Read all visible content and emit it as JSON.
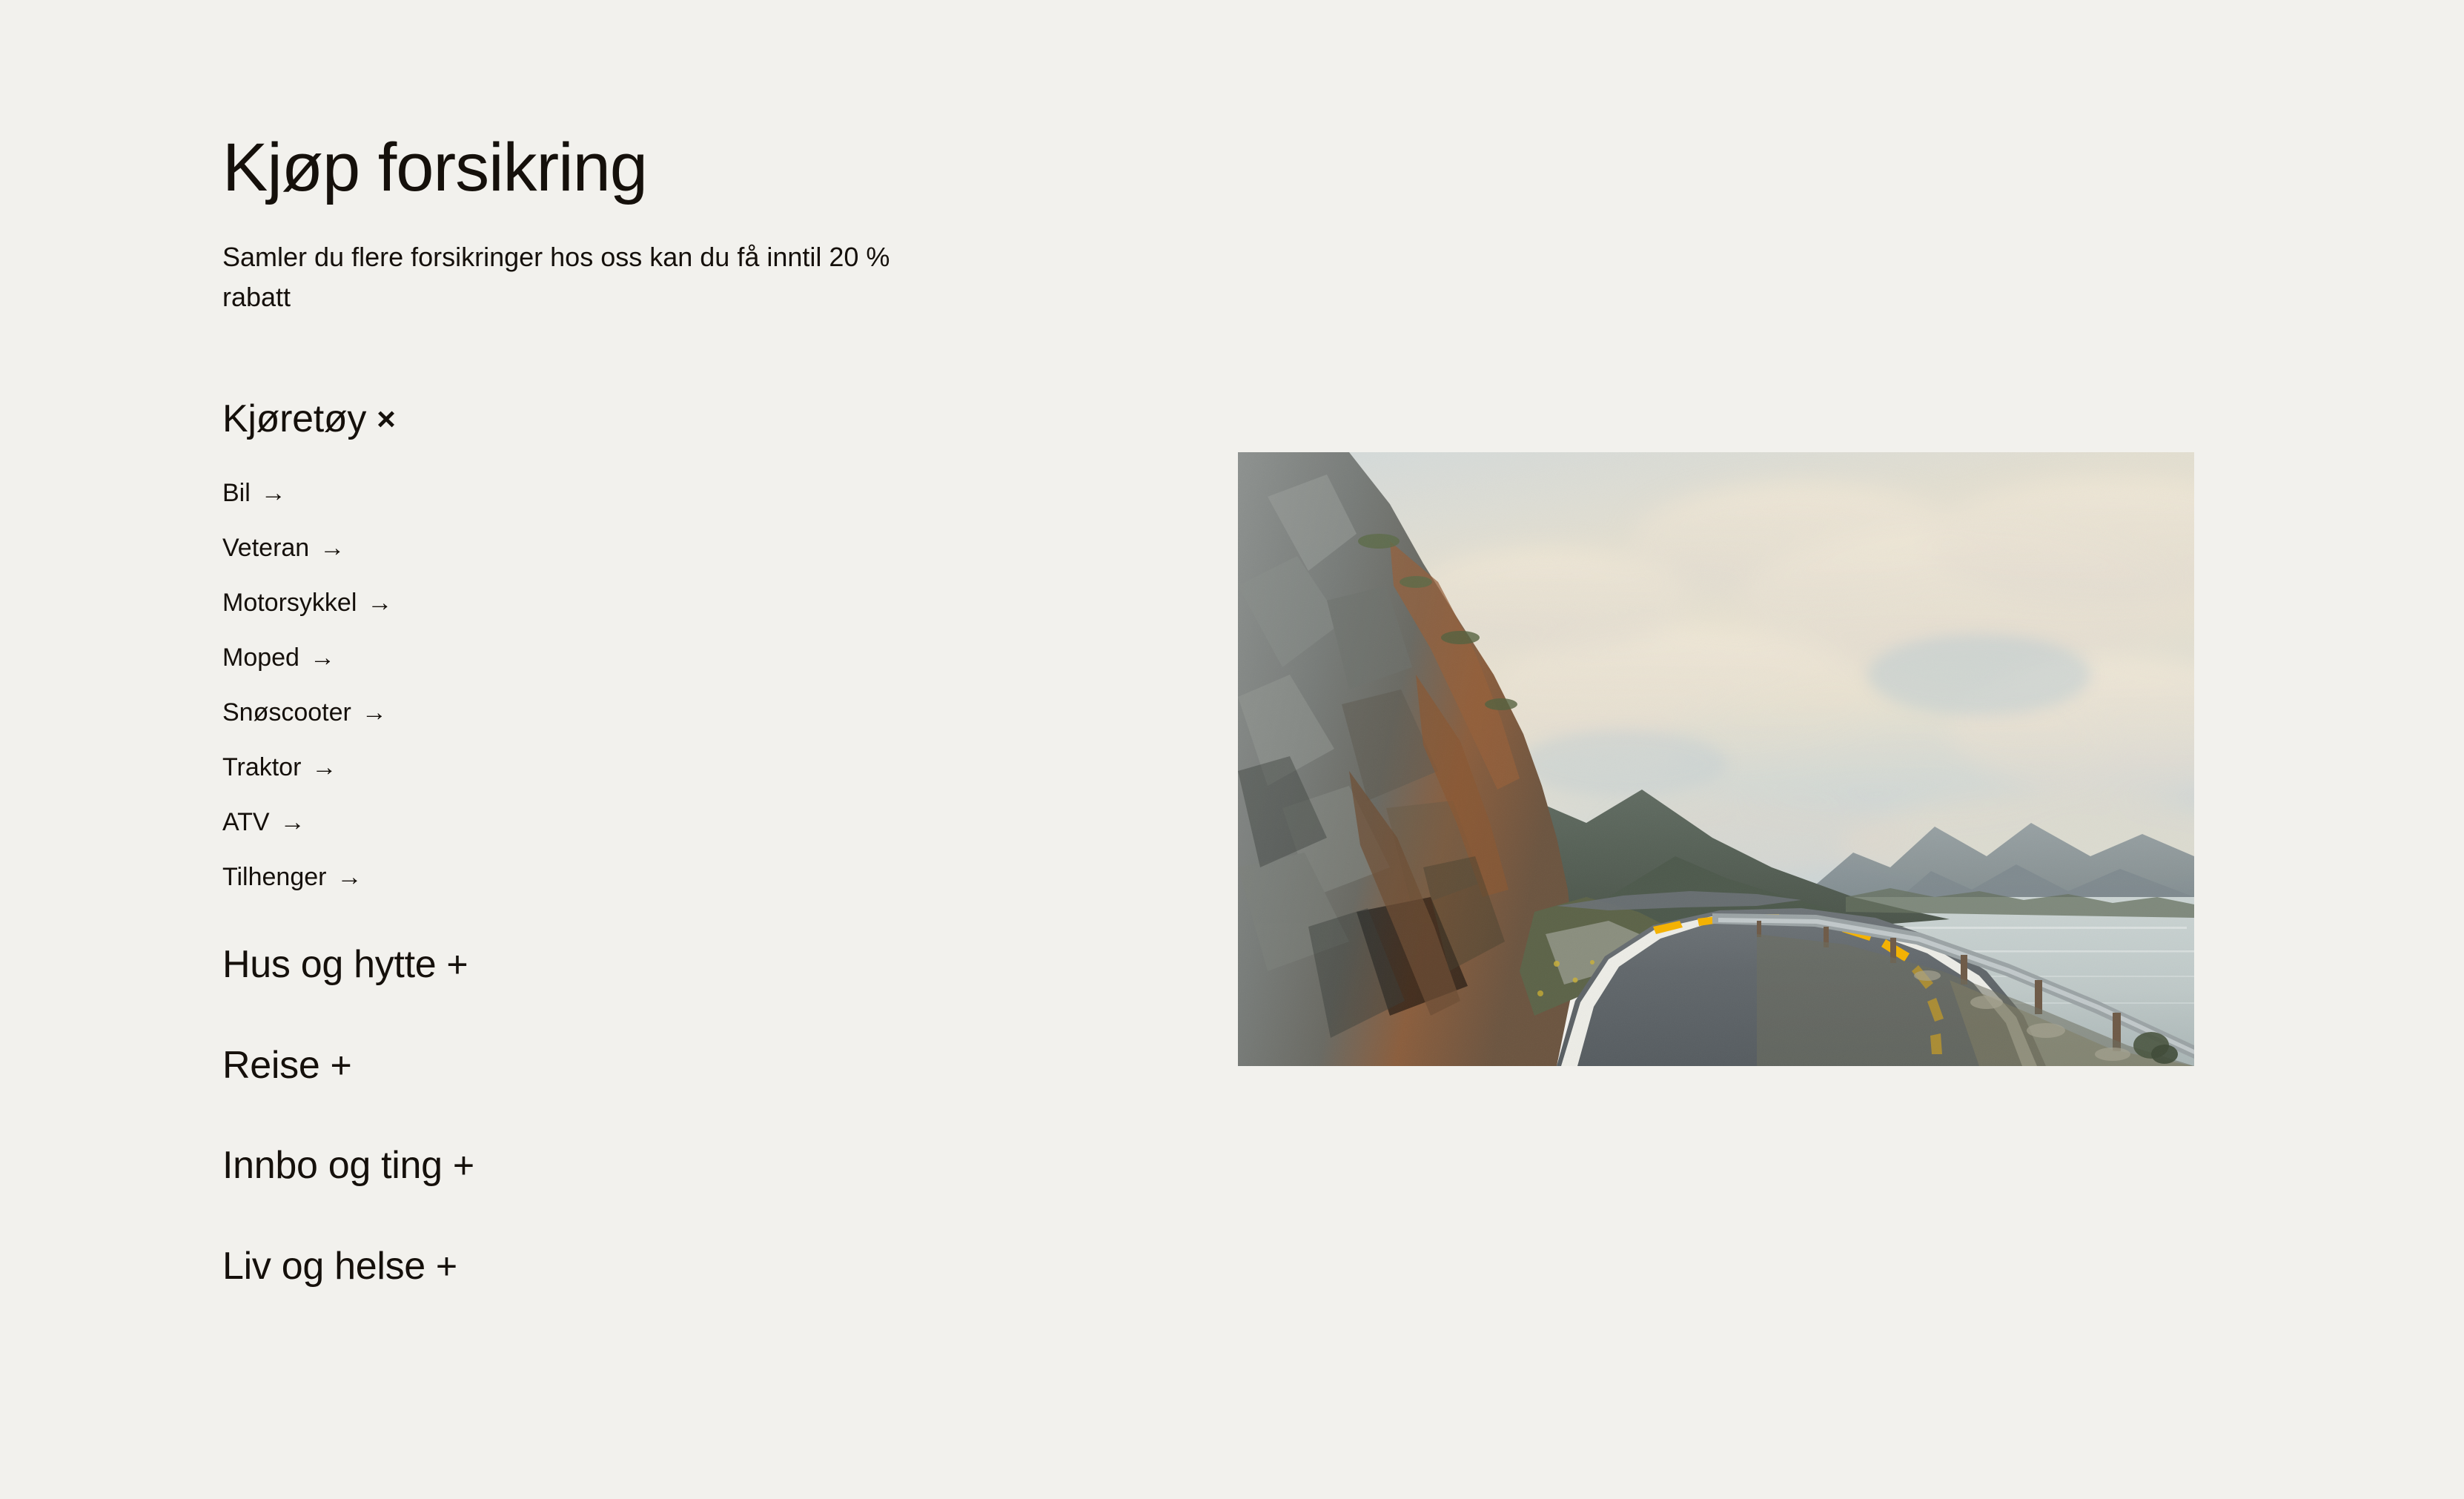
{
  "page": {
    "title": "Kjøp forsikring",
    "intro": "Samler du flere forsikringer hos oss kan du få inntil 20 % rabatt",
    "background_color": "#F2F1ED",
    "text_color": "#15100B"
  },
  "accordion": {
    "expanded_symbol": "×",
    "collapsed_symbol": "+",
    "link_arrow": "→",
    "items": [
      {
        "label": "Kjøretøy",
        "state": "expanded",
        "symbol": "×",
        "links": [
          {
            "label": "Bil",
            "arrow": "→"
          },
          {
            "label": "Veteran",
            "arrow": "→"
          },
          {
            "label": "Motorsykkel",
            "arrow": "→"
          },
          {
            "label": "Moped",
            "arrow": "→"
          },
          {
            "label": "Snøscooter",
            "arrow": "→"
          },
          {
            "label": "Traktor",
            "arrow": "→"
          },
          {
            "label": "ATV",
            "arrow": "→"
          },
          {
            "label": "Tilhenger",
            "arrow": "→"
          }
        ]
      },
      {
        "label": "Hus og hytte",
        "state": "collapsed",
        "symbol": "+",
        "links": []
      },
      {
        "label": "Reise",
        "state": "collapsed",
        "symbol": "+",
        "links": []
      },
      {
        "label": "Innbo og ting",
        "state": "collapsed",
        "symbol": "+",
        "links": []
      },
      {
        "label": "Liv og helse",
        "state": "collapsed",
        "symbol": "+",
        "links": []
      }
    ]
  },
  "photo": {
    "description": "Coastal mountain road curving along a fjord with steep rock cliff on the left, guardrail and water on the right, cloudy sky",
    "colors": {
      "sky_warm": "#E8E0CE",
      "sky_blue": "#C3D0D3",
      "cliff_grey": "#7D7F7C",
      "cliff_rust": "#8A5C3C",
      "mountain_green": "#55604F",
      "mountain_far": "#7C878C",
      "water": "#C3CCCB",
      "asphalt": "#5E6468",
      "center_line": "#F5B500",
      "edge_line": "#E8E8E4",
      "guardrail": "#9AA2A4",
      "grass": "#6E7344"
    }
  }
}
